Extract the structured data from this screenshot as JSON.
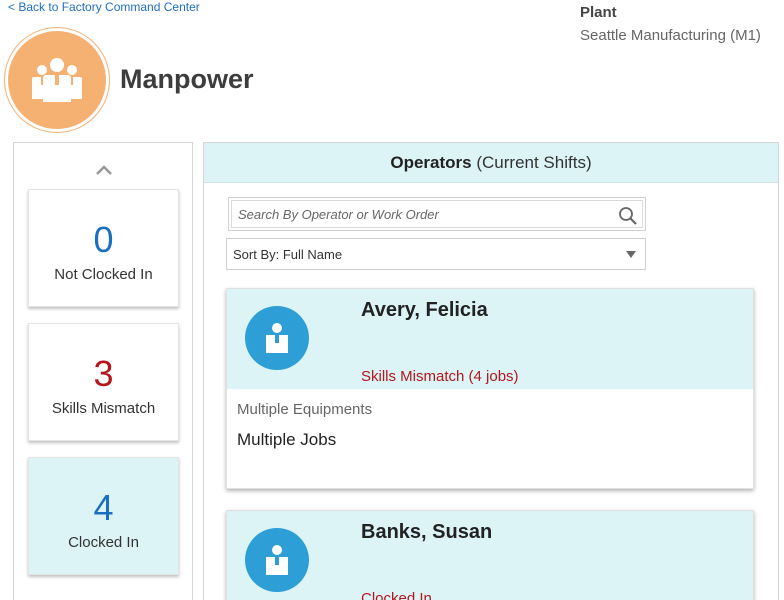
{
  "nav": {
    "back_label": "< Back to Factory Command Center"
  },
  "plant": {
    "label": "Plant",
    "value": "Seattle Manufacturing (M1)"
  },
  "header": {
    "title": "Manpower",
    "icon": "group-users-icon"
  },
  "summary": {
    "cards": [
      {
        "count": "0",
        "label": "Not Clocked In",
        "color": "#1b6fc1"
      },
      {
        "count": "3",
        "label": "Skills Mismatch",
        "color": "#b3161c"
      },
      {
        "count": "4",
        "label": "Clocked In",
        "color": "#1b6fc1",
        "selected": true
      }
    ]
  },
  "operators": {
    "title": "Operators",
    "subtitle": "(Current Shifts)",
    "search_placeholder": "Search By Operator or Work Order",
    "sort_label": "Sort By: Full Name",
    "list": [
      {
        "name": "Avery, Felicia",
        "status": "Skills Mismatch (4 jobs)",
        "equipment": "Multiple Equipments",
        "jobs": "Multiple Jobs"
      },
      {
        "name": "Banks, Susan",
        "status": "Clocked In",
        "equipment": "",
        "jobs": ""
      }
    ]
  },
  "colors": {
    "accent_orange": "#f4b172",
    "panel_highlight": "#dcf4f6",
    "avatar_blue": "#2e9fd6",
    "alert_red": "#b3161c",
    "count_blue": "#1b6fc1"
  }
}
